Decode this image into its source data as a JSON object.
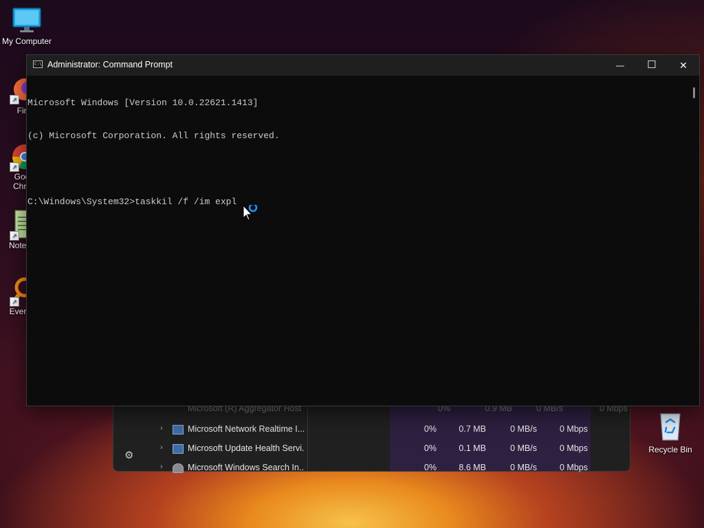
{
  "desktop": {
    "icons": [
      {
        "label": "My Computer"
      },
      {
        "label": "Fire"
      },
      {
        "label": "Goo"
      },
      {
        "label": "Chro"
      },
      {
        "label": "Notep"
      },
      {
        "label": "Every"
      },
      {
        "label": "Recycle Bin"
      }
    ]
  },
  "cmd": {
    "title": "Administrator: Command Prompt",
    "app_icon_text": "C:\\",
    "lines": [
      "Microsoft Windows [Version 10.0.22621.1413]",
      "(c) Microsoft Corporation. All rights reserved.",
      "",
      "C:\\Windows\\System32>taskkil /f /im expl"
    ],
    "buttons": {
      "minimize": "—",
      "maximize": "☐",
      "close": "✕"
    }
  },
  "taskmanager": {
    "rows": [
      {
        "name": "Microsoft (R) Aggregator Host",
        "cpu": "0%",
        "memory": "0.9 MB",
        "disk": "0 MB/s",
        "network": "0 Mbps"
      },
      {
        "name": "Microsoft Network Realtime I...",
        "cpu": "0%",
        "memory": "0.7 MB",
        "disk": "0 MB/s",
        "network": "0 Mbps"
      },
      {
        "name": "Microsoft Update Health Servi...",
        "cpu": "0%",
        "memory": "0.1 MB",
        "disk": "0 MB/s",
        "network": "0 Mbps"
      },
      {
        "name": "Microsoft Windows Search In...",
        "cpu": "0%",
        "memory": "8.6 MB",
        "disk": "0 MB/s",
        "network": "0 Mbps"
      }
    ]
  },
  "colors": {
    "accent": "#0078d4",
    "terminal_bg": "#0c0c0c",
    "terminal_fg": "#cccccc"
  }
}
